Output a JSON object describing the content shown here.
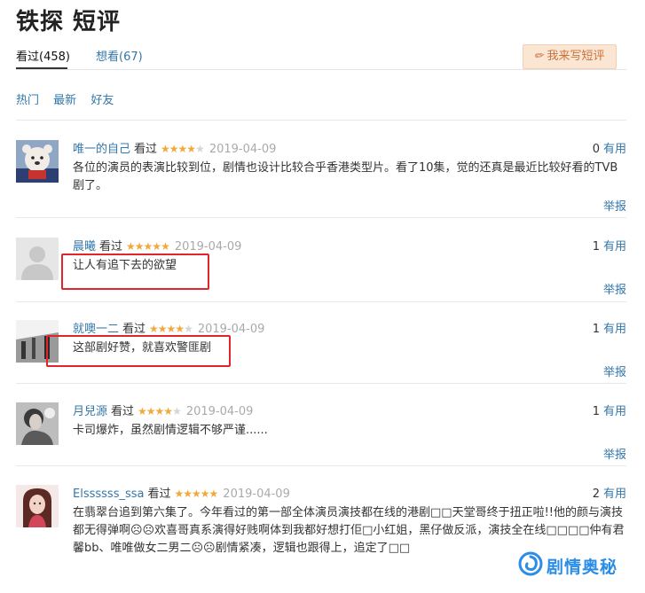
{
  "page": {
    "title": "铁探 短评"
  },
  "tabs": {
    "watched": "看过(458)",
    "want": "想看(67)"
  },
  "write_button": "我来写短评",
  "filters": [
    "热门",
    "最新",
    "好友"
  ],
  "colors": {
    "link": "#3377aa",
    "star": "#f2a93b",
    "highlight_box": "#e0262b",
    "button_bg": "#fbe6d4",
    "button_text": "#c8733a"
  },
  "reviews": [
    {
      "author": "唯一的自己",
      "status": "看过",
      "rating": 4,
      "date": "2019-04-09",
      "votes": "0",
      "useful": "有用",
      "content": "各位的演员的表演比较到位，剧情也设计比较合乎香港类型片。看了10集，觉的还真是最近比较好看的TVB剧了。",
      "report": "举报",
      "avatar_icon": "plush-bear-avatar"
    },
    {
      "author": "晨曦",
      "status": "看过",
      "rating": 5,
      "date": "2019-04-09",
      "votes": "1",
      "useful": "有用",
      "content": "让人有追下去的欲望",
      "report": "举报",
      "avatar_icon": "default-user-avatar"
    },
    {
      "author": "就噢一二",
      "status": "看过",
      "rating": 4,
      "date": "2019-04-09",
      "votes": "1",
      "useful": "有用",
      "content": "这部剧好赞，就喜欢警匪剧",
      "report": "举报",
      "avatar_icon": "photo-avatar"
    },
    {
      "author": "月兒源",
      "status": "看过",
      "rating": 4,
      "date": "2019-04-09",
      "votes": "1",
      "useful": "有用",
      "content": "卡司爆炸，虽然剧情逻辑不够严谨......",
      "report": "举报",
      "avatar_icon": "photo-avatar"
    },
    {
      "author": "Elssssss_ssa",
      "status": "看过",
      "rating": 5,
      "date": "2019-04-09",
      "votes": "2",
      "useful": "有用",
      "content": "在翡翠台追到第六集了。今年看过的第一部全体演员演技都在线的港剧□□天堂哥终于扭正啦!!他的颜与演技都无得弹啊☹☹欢喜哥真系演得好贱啊体到我都好想打佢□小红姐，黑仔做反派，演技全在线□□□□仲有君馨bb、唯唯做女二男二☹☹剧情紧凑，逻辑也跟得上，追定了□□",
      "report": "举报",
      "avatar_icon": "photo-avatar"
    }
  ],
  "watermark": {
    "text": "剧情奥秘",
    "icon": "swirl-logo-icon"
  }
}
